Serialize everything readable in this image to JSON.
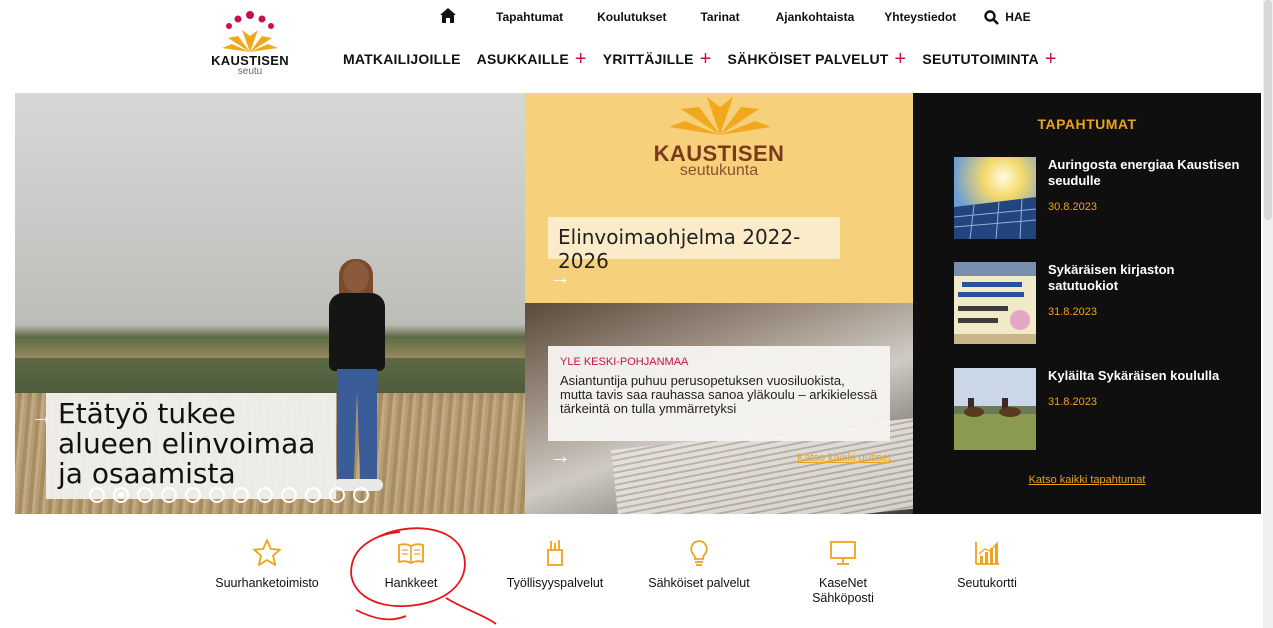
{
  "logo": {
    "name": "KAUSTISEN",
    "sub": "seutu"
  },
  "topnav": {
    "items": [
      "Tapahtumat",
      "Koulutukset",
      "Tarinat",
      "Ajankohtaista",
      "Yhteystiedot"
    ],
    "search_label": "HAE"
  },
  "mainnav": {
    "items": [
      "MATKAILIJOILLE",
      "ASUKKAILLE",
      "YRITTÄJILLE",
      "SÄHKÖISET PALVELUT",
      "SEUTUTOIMINTA"
    ]
  },
  "hero": {
    "main_title": "Etätyö tukee alueen elinvoimaa ja osaamista",
    "slides_count": 12,
    "active_slide": 2,
    "brand_title": "KAUSTISEN",
    "brand_sub": "seutukunta",
    "program_title": "Elinvoimaohjelma 2022-2026",
    "news_source": "YLE KESKI-POHJANMAA",
    "news_text": "Asiantuntija puhuu perusopetuksen vuosiluokista, mutta tavis saa rauhassa sanoa yläkoulu – arkikielessä tärkeintä on tulla ymmärretyksi",
    "all_news": "Katso kaikki uutiset"
  },
  "events": {
    "title": "TAPAHTUMAT",
    "items": [
      {
        "title": "Auringosta energiaa Kaustisen seudulle",
        "date": "30.8.2023"
      },
      {
        "title": "Sykäräisen kirjaston satutuokiot",
        "date": "31.8.2023"
      },
      {
        "title": "Kyläilta Sykäräisen koululla",
        "date": "31.8.2023"
      }
    ],
    "all_events": "Katso kaikki tapahtumat"
  },
  "quicklinks": [
    {
      "label": "Suurhanketoimisto",
      "icon": "star-icon"
    },
    {
      "label": "Hankkeet",
      "icon": "book-icon"
    },
    {
      "label": "Työllisyyspalvelut",
      "icon": "pencil-cup-icon"
    },
    {
      "label": "Sähköiset palvelut",
      "icon": "lightbulb-icon"
    },
    {
      "label": "KaseNet Sähköposti",
      "icon": "monitor-icon"
    },
    {
      "label": "Seutukortti",
      "icon": "chart-icon"
    }
  ],
  "colors": {
    "accent": "#f0a21a",
    "plus": "#c4124a",
    "events_bg": "#0f0f0f",
    "annotation": "#e8141b"
  }
}
